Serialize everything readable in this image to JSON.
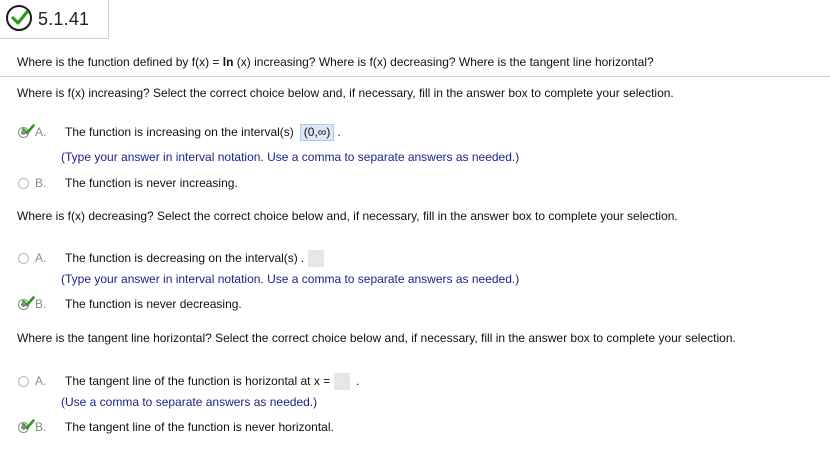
{
  "header": {
    "title": "5.1.41",
    "status_icon": "check-circle-icon",
    "status_color": "#2a9a1a"
  },
  "question": {
    "pre": "Where is the function defined by f(x) = ",
    "func": "ln",
    "post": " (x) increasing? Where is f(x) decreasing? Where is the tangent line horizontal?"
  },
  "parts": [
    {
      "prompt": "Where is f(x) increasing? Select the correct choice below and, if necessary, fill in the answer box to complete your selection.",
      "choices": [
        {
          "letter": "A.",
          "text": "The function is increasing on the interval(s)",
          "answer": "(0,∞)",
          "suffix": ".",
          "hint": "(Type your answer in interval notation. Use a comma to separate answers as needed.)",
          "selected": true
        },
        {
          "letter": "B.",
          "text": "The function is never increasing.",
          "selected": false
        }
      ]
    },
    {
      "prompt": "Where is f(x) decreasing? Select the correct choice below and, if necessary, fill in the answer box to complete your selection.",
      "choices": [
        {
          "letter": "A.",
          "text": "The function is decreasing on the interval(s)",
          "answer": "",
          "suffix": ".",
          "hint": "(Type your answer in interval notation. Use a comma to separate answers as needed.)",
          "selected": false
        },
        {
          "letter": "B.",
          "text": "The function is never decreasing.",
          "selected": true
        }
      ]
    },
    {
      "prompt": "Where is the tangent line horizontal? Select the correct choice below and, if necessary, fill in the answer box to complete your selection.",
      "choices": [
        {
          "letter": "A.",
          "text": "The tangent line of the function is horizontal at x =",
          "answer": "",
          "suffix": ".",
          "hint": "(Use a comma to separate answers as needed.)",
          "selected": false
        },
        {
          "letter": "B.",
          "text": "The tangent line of the function is never horizontal.",
          "selected": true
        }
      ]
    }
  ]
}
